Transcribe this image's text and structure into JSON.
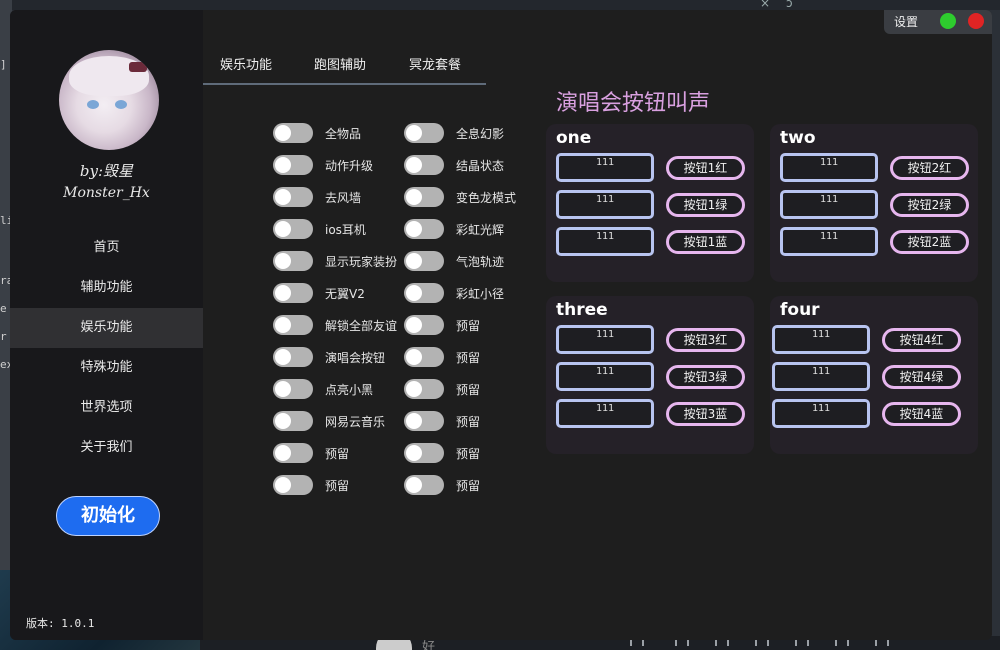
{
  "sidebar": {
    "author_by": "by:毁星",
    "author_name": "Monster_Hx",
    "nav": [
      "首页",
      "辅助功能",
      "娱乐功能",
      "特殊功能",
      "世界选项",
      "关于我们"
    ],
    "active_index": 2,
    "init_button": "初始化",
    "version": "版本: 1.0.1"
  },
  "tabs": [
    "娱乐功能",
    "跑图辅助",
    "冥龙套餐"
  ],
  "toggles": {
    "left": [
      "全物品",
      "动作升级",
      "去风墙",
      "ios耳机",
      "显示玩家装扮",
      "无翼V2",
      "解锁全部友谊",
      "演唱会按钮",
      "点亮小黑",
      "网易云音乐",
      "预留",
      "预留"
    ],
    "right": [
      "全息幻影",
      "结晶状态",
      "变色龙模式",
      "彩虹光辉",
      "气泡轨迹",
      "彩虹小径",
      "预留",
      "预留",
      "预留",
      "预留",
      "预留",
      "预留"
    ]
  },
  "concert": {
    "title": "演唱会按钮叫声",
    "cards": [
      {
        "title": "one",
        "fields": [
          "111",
          "111",
          "111"
        ],
        "buttons": [
          "按钮1红",
          "按钮1绿",
          "按钮1蓝"
        ]
      },
      {
        "title": "two",
        "fields": [
          "111",
          "111",
          "111"
        ],
        "buttons": [
          "按钮2红",
          "按钮2绿",
          "按钮2蓝"
        ]
      },
      {
        "title": "three",
        "fields": [
          "111",
          "111",
          "111"
        ],
        "buttons": [
          "按钮3红",
          "按钮3绿",
          "按钮3蓝"
        ]
      },
      {
        "title": "four",
        "fields": [
          "111",
          "111",
          "111"
        ],
        "buttons": [
          "按钮4红",
          "按钮4绿",
          "按钮4蓝"
        ]
      }
    ]
  },
  "titlebar": {
    "settings": "设置",
    "green_color": "#2ecc2e",
    "red_color": "#e02424"
  },
  "background": {
    "left_fragments": [
      "]",
      "lil",
      "ra",
      "e",
      "r",
      "ex"
    ],
    "bottom_text": "好"
  }
}
